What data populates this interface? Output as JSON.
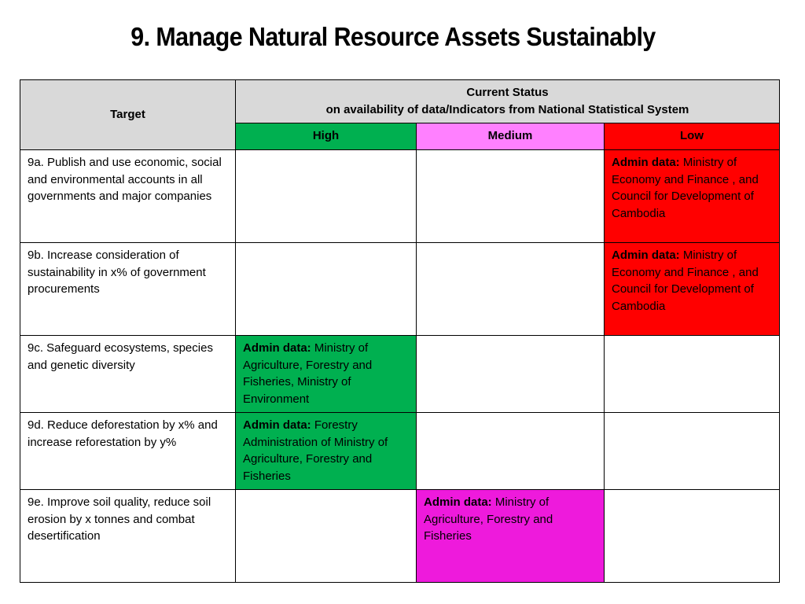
{
  "title": "9. Manage Natural Resource Assets Sustainably",
  "table": {
    "header": {
      "target": "Target",
      "status_line1": "Current Status",
      "status_line2": "on availability of  data/Indicators from National Statistical System",
      "high": "High",
      "medium": "Medium",
      "low": "Low"
    },
    "colors": {
      "header_gray": "#d9d9d9",
      "high_green": "#00b050",
      "medium_pink": "#ff80ff",
      "medium_cell_magenta": "#ee1adc",
      "low_red": "#ff0000"
    },
    "rows": [
      {
        "target": "9a. Publish and use economic, social and environmental accounts in all governments and major companies",
        "high": {
          "label": "",
          "text": ""
        },
        "medium": {
          "label": "",
          "text": ""
        },
        "low": {
          "label": "Admin data:",
          "text": "Ministry of Economy and Finance , and Council for Development of Cambodia"
        }
      },
      {
        "target": "9b. Increase consideration of sustainability in x% of government procurements",
        "high": {
          "label": "",
          "text": ""
        },
        "medium": {
          "label": "",
          "text": ""
        },
        "low": {
          "label": "Admin data:",
          "text": "Ministry of Economy and Finance , and Council for Development of Cambodia"
        }
      },
      {
        "target": "9c. Safeguard ecosystems, species and genetic diversity",
        "high": {
          "label": "Admin data:",
          "text": "Ministry of Agriculture, Forestry and Fisheries,  Ministry of Environment"
        },
        "medium": {
          "label": "",
          "text": ""
        },
        "low": {
          "label": "",
          "text": ""
        }
      },
      {
        "target": "9d. Reduce deforestation by x% and increase reforestation by y%",
        "high": {
          "label": "Admin data:",
          "text": "Forestry Administration of Ministry of Agriculture, Forestry and Fisheries"
        },
        "medium": {
          "label": "",
          "text": ""
        },
        "low": {
          "label": "",
          "text": ""
        }
      },
      {
        "target": "9e. Improve soil quality, reduce soil erosion by x tonnes and combat desertification",
        "high": {
          "label": "",
          "text": ""
        },
        "medium": {
          "label": "Admin data:",
          "text": "Ministry of Agriculture, Forestry and Fisheries"
        },
        "low": {
          "label": "",
          "text": ""
        }
      }
    ]
  }
}
